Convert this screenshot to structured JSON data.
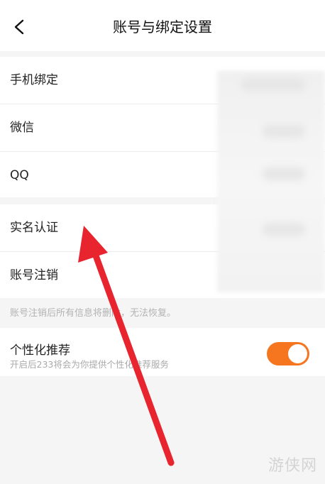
{
  "header": {
    "title": "账号与绑定设置",
    "back_icon": "chevron-left-icon"
  },
  "bindings": {
    "items": [
      {
        "label": "手机绑定"
      },
      {
        "label": "微信"
      },
      {
        "label": "QQ"
      }
    ]
  },
  "account": {
    "items": [
      {
        "label": "实名认证"
      },
      {
        "label": "账号注销"
      }
    ],
    "notice": "账号注销后所有信息将删除，无法恢复。"
  },
  "personalization": {
    "title": "个性化推荐",
    "description": "开启后233将会为你提供个性化推荐服务",
    "enabled": true,
    "toggle_color": "#f5761e"
  },
  "watermark": "游侠网",
  "colors": {
    "arrow": "#e8242f",
    "background": "#f5f5f5"
  }
}
